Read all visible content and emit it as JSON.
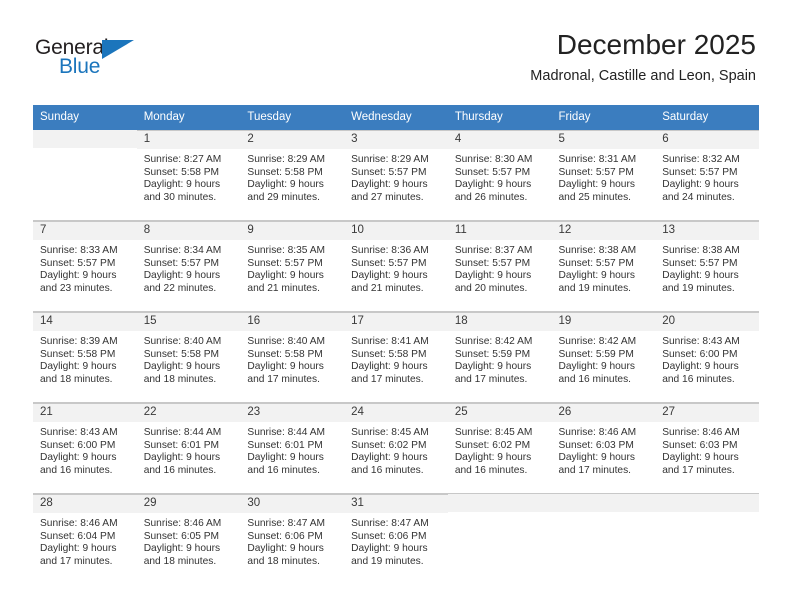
{
  "brand": {
    "name_top": "General",
    "name_bottom": "Blue",
    "accent_color": "#1b75bc"
  },
  "header": {
    "month_title": "December 2025",
    "location": "Madronal, Castille and Leon, Spain",
    "header_bg": "#3b7dbf"
  },
  "weekdays": [
    "Sunday",
    "Monday",
    "Tuesday",
    "Wednesday",
    "Thursday",
    "Friday",
    "Saturday"
  ],
  "weeks": [
    [
      {
        "date": "",
        "sunrise": "",
        "sunset": "",
        "daylight1": "",
        "daylight2": ""
      },
      {
        "date": "1",
        "sunrise": "Sunrise: 8:27 AM",
        "sunset": "Sunset: 5:58 PM",
        "daylight1": "Daylight: 9 hours",
        "daylight2": "and 30 minutes."
      },
      {
        "date": "2",
        "sunrise": "Sunrise: 8:29 AM",
        "sunset": "Sunset: 5:58 PM",
        "daylight1": "Daylight: 9 hours",
        "daylight2": "and 29 minutes."
      },
      {
        "date": "3",
        "sunrise": "Sunrise: 8:29 AM",
        "sunset": "Sunset: 5:57 PM",
        "daylight1": "Daylight: 9 hours",
        "daylight2": "and 27 minutes."
      },
      {
        "date": "4",
        "sunrise": "Sunrise: 8:30 AM",
        "sunset": "Sunset: 5:57 PM",
        "daylight1": "Daylight: 9 hours",
        "daylight2": "and 26 minutes."
      },
      {
        "date": "5",
        "sunrise": "Sunrise: 8:31 AM",
        "sunset": "Sunset: 5:57 PM",
        "daylight1": "Daylight: 9 hours",
        "daylight2": "and 25 minutes."
      },
      {
        "date": "6",
        "sunrise": "Sunrise: 8:32 AM",
        "sunset": "Sunset: 5:57 PM",
        "daylight1": "Daylight: 9 hours",
        "daylight2": "and 24 minutes."
      }
    ],
    [
      {
        "date": "7",
        "sunrise": "Sunrise: 8:33 AM",
        "sunset": "Sunset: 5:57 PM",
        "daylight1": "Daylight: 9 hours",
        "daylight2": "and 23 minutes."
      },
      {
        "date": "8",
        "sunrise": "Sunrise: 8:34 AM",
        "sunset": "Sunset: 5:57 PM",
        "daylight1": "Daylight: 9 hours",
        "daylight2": "and 22 minutes."
      },
      {
        "date": "9",
        "sunrise": "Sunrise: 8:35 AM",
        "sunset": "Sunset: 5:57 PM",
        "daylight1": "Daylight: 9 hours",
        "daylight2": "and 21 minutes."
      },
      {
        "date": "10",
        "sunrise": "Sunrise: 8:36 AM",
        "sunset": "Sunset: 5:57 PM",
        "daylight1": "Daylight: 9 hours",
        "daylight2": "and 21 minutes."
      },
      {
        "date": "11",
        "sunrise": "Sunrise: 8:37 AM",
        "sunset": "Sunset: 5:57 PM",
        "daylight1": "Daylight: 9 hours",
        "daylight2": "and 20 minutes."
      },
      {
        "date": "12",
        "sunrise": "Sunrise: 8:38 AM",
        "sunset": "Sunset: 5:57 PM",
        "daylight1": "Daylight: 9 hours",
        "daylight2": "and 19 minutes."
      },
      {
        "date": "13",
        "sunrise": "Sunrise: 8:38 AM",
        "sunset": "Sunset: 5:57 PM",
        "daylight1": "Daylight: 9 hours",
        "daylight2": "and 19 minutes."
      }
    ],
    [
      {
        "date": "14",
        "sunrise": "Sunrise: 8:39 AM",
        "sunset": "Sunset: 5:58 PM",
        "daylight1": "Daylight: 9 hours",
        "daylight2": "and 18 minutes."
      },
      {
        "date": "15",
        "sunrise": "Sunrise: 8:40 AM",
        "sunset": "Sunset: 5:58 PM",
        "daylight1": "Daylight: 9 hours",
        "daylight2": "and 18 minutes."
      },
      {
        "date": "16",
        "sunrise": "Sunrise: 8:40 AM",
        "sunset": "Sunset: 5:58 PM",
        "daylight1": "Daylight: 9 hours",
        "daylight2": "and 17 minutes."
      },
      {
        "date": "17",
        "sunrise": "Sunrise: 8:41 AM",
        "sunset": "Sunset: 5:58 PM",
        "daylight1": "Daylight: 9 hours",
        "daylight2": "and 17 minutes."
      },
      {
        "date": "18",
        "sunrise": "Sunrise: 8:42 AM",
        "sunset": "Sunset: 5:59 PM",
        "daylight1": "Daylight: 9 hours",
        "daylight2": "and 17 minutes."
      },
      {
        "date": "19",
        "sunrise": "Sunrise: 8:42 AM",
        "sunset": "Sunset: 5:59 PM",
        "daylight1": "Daylight: 9 hours",
        "daylight2": "and 16 minutes."
      },
      {
        "date": "20",
        "sunrise": "Sunrise: 8:43 AM",
        "sunset": "Sunset: 6:00 PM",
        "daylight1": "Daylight: 9 hours",
        "daylight2": "and 16 minutes."
      }
    ],
    [
      {
        "date": "21",
        "sunrise": "Sunrise: 8:43 AM",
        "sunset": "Sunset: 6:00 PM",
        "daylight1": "Daylight: 9 hours",
        "daylight2": "and 16 minutes."
      },
      {
        "date": "22",
        "sunrise": "Sunrise: 8:44 AM",
        "sunset": "Sunset: 6:01 PM",
        "daylight1": "Daylight: 9 hours",
        "daylight2": "and 16 minutes."
      },
      {
        "date": "23",
        "sunrise": "Sunrise: 8:44 AM",
        "sunset": "Sunset: 6:01 PM",
        "daylight1": "Daylight: 9 hours",
        "daylight2": "and 16 minutes."
      },
      {
        "date": "24",
        "sunrise": "Sunrise: 8:45 AM",
        "sunset": "Sunset: 6:02 PM",
        "daylight1": "Daylight: 9 hours",
        "daylight2": "and 16 minutes."
      },
      {
        "date": "25",
        "sunrise": "Sunrise: 8:45 AM",
        "sunset": "Sunset: 6:02 PM",
        "daylight1": "Daylight: 9 hours",
        "daylight2": "and 16 minutes."
      },
      {
        "date": "26",
        "sunrise": "Sunrise: 8:46 AM",
        "sunset": "Sunset: 6:03 PM",
        "daylight1": "Daylight: 9 hours",
        "daylight2": "and 17 minutes."
      },
      {
        "date": "27",
        "sunrise": "Sunrise: 8:46 AM",
        "sunset": "Sunset: 6:03 PM",
        "daylight1": "Daylight: 9 hours",
        "daylight2": "and 17 minutes."
      }
    ],
    [
      {
        "date": "28",
        "sunrise": "Sunrise: 8:46 AM",
        "sunset": "Sunset: 6:04 PM",
        "daylight1": "Daylight: 9 hours",
        "daylight2": "and 17 minutes."
      },
      {
        "date": "29",
        "sunrise": "Sunrise: 8:46 AM",
        "sunset": "Sunset: 6:05 PM",
        "daylight1": "Daylight: 9 hours",
        "daylight2": "and 18 minutes."
      },
      {
        "date": "30",
        "sunrise": "Sunrise: 8:47 AM",
        "sunset": "Sunset: 6:06 PM",
        "daylight1": "Daylight: 9 hours",
        "daylight2": "and 18 minutes."
      },
      {
        "date": "31",
        "sunrise": "Sunrise: 8:47 AM",
        "sunset": "Sunset: 6:06 PM",
        "daylight1": "Daylight: 9 hours",
        "daylight2": "and 19 minutes."
      },
      {
        "date": "",
        "sunrise": "",
        "sunset": "",
        "daylight1": "",
        "daylight2": ""
      },
      {
        "date": "",
        "sunrise": "",
        "sunset": "",
        "daylight1": "",
        "daylight2": ""
      },
      {
        "date": "",
        "sunrise": "",
        "sunset": "",
        "daylight1": "",
        "daylight2": ""
      }
    ]
  ]
}
